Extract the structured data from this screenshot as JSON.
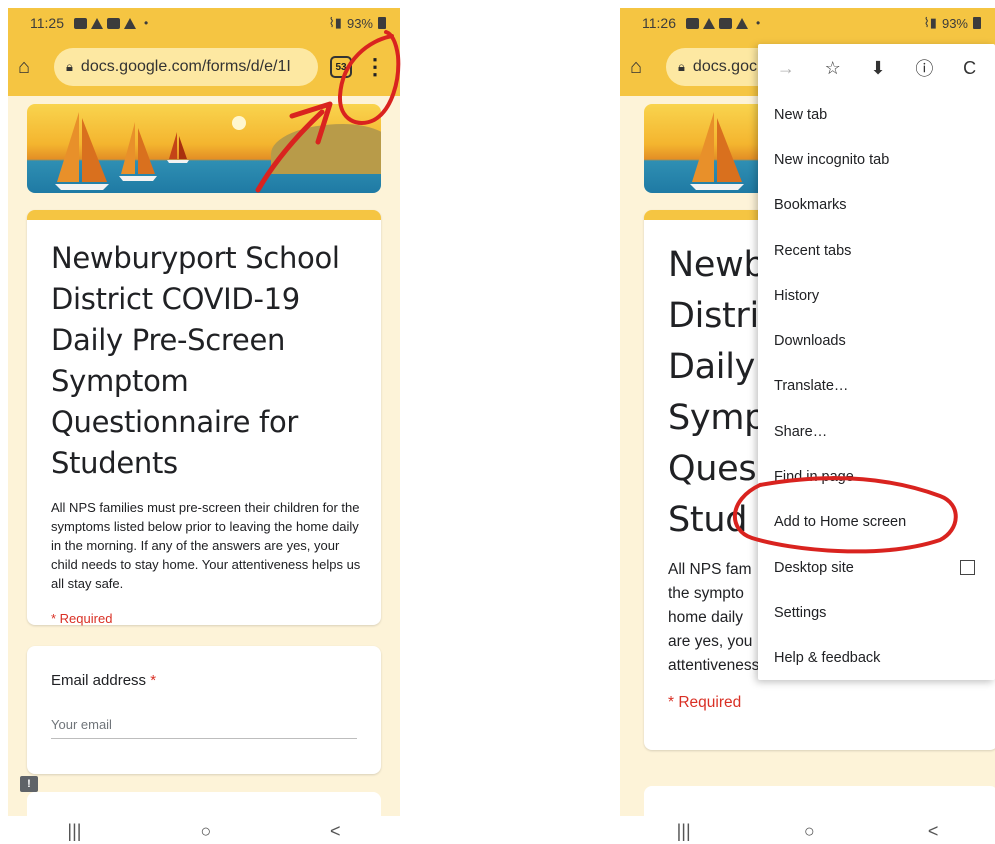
{
  "left": {
    "status": {
      "time": "11:25",
      "dot": "•",
      "signal": "",
      "battery": "93%"
    },
    "url": {
      "text": "docs.google.com/forms/d/e/1I",
      "tabs": "53"
    },
    "form": {
      "title": "Newburyport School District COVID-19 Daily Pre-Screen Symptom Questionnaire for Students",
      "description": "All NPS families must pre-screen their children for the symptoms listed below prior to leaving the home daily in the morning. If any of the answers are yes, your child needs to stay home.   Your attentiveness helps us all stay safe.",
      "required_note": "* Required"
    },
    "email": {
      "label": "Email address",
      "star": "*",
      "placeholder": "Your email"
    },
    "feedback_glyph": "!",
    "nav": {
      "recent": "|||",
      "home": "○",
      "back": "<"
    }
  },
  "right": {
    "status": {
      "time": "11:26",
      "dot": "•",
      "battery": "93%"
    },
    "url": {
      "text": "docs.goc"
    },
    "form": {
      "title_lines": [
        "Newb",
        "Distri",
        "Daily",
        "Symp",
        "Ques",
        "Stud"
      ],
      "desc_lines": [
        "All NPS fam",
        "the sympto",
        "home daily",
        "are yes, you",
        "attentiveness helps us all stay safe."
      ],
      "required_note": "* Required"
    },
    "menu": {
      "toolbar": {
        "forward": "→",
        "star": "☆",
        "download": "⬇",
        "info": "ⓘ",
        "refresh": "C"
      },
      "items": [
        "New tab",
        "New incognito tab",
        "Bookmarks",
        "Recent tabs",
        "History",
        "Downloads",
        "Translate…",
        "Share…",
        "Find in page",
        "Add to Home screen",
        "Desktop site",
        "Settings",
        "Help & feedback"
      ]
    },
    "nav": {
      "recent": "|||",
      "home": "○",
      "back": "<"
    }
  },
  "annotation_color": "#d9231f",
  "theme_color": "#f5c542"
}
